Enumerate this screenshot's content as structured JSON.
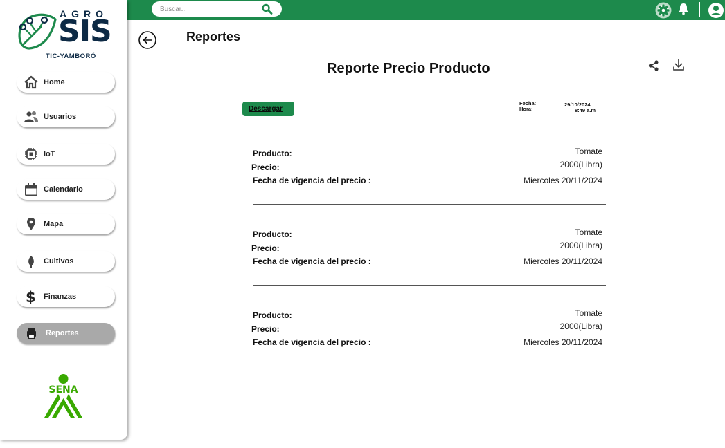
{
  "search": {
    "placeholder": "Buscar..."
  },
  "logo": {
    "brand_top": "AGRO",
    "brand_main": "SIS",
    "brand_sub": "TIC-YAMBORÓ"
  },
  "sidebar": {
    "items": [
      {
        "label": "Home",
        "icon": "home-icon"
      },
      {
        "label": "Usuarios",
        "icon": "users-icon"
      },
      {
        "label": "IoT",
        "icon": "chip-icon"
      },
      {
        "label": "Calendario",
        "icon": "calendar-icon"
      },
      {
        "label": "Mapa",
        "icon": "map-pin-icon"
      },
      {
        "label": "Cultivos",
        "icon": "leaf-icon"
      },
      {
        "label": "Finanzas",
        "icon": "dollar-icon"
      },
      {
        "label": "Reportes",
        "icon": "printer-icon",
        "active": true
      }
    ],
    "footer_logo_text": "SENA"
  },
  "header": {
    "title": "Reportes"
  },
  "report": {
    "title": "Reporte Precio Producto",
    "download_label": "Descargar",
    "fecha_label": "Fecha:",
    "fecha_value": "29/10/2024",
    "hora_label": "Hora:",
    "hora_value": "8:49 a.m",
    "records": [
      {
        "producto_label": "Producto:",
        "producto": "Tomate",
        "precio_label": "Precio:",
        "precio": "2000(Libra)",
        "vigencia_label": "Fecha de vigencia del precio :",
        "vigencia": "Miercoles 20/11/2024"
      },
      {
        "producto_label": "Producto:",
        "producto": "Tomate",
        "precio_label": "Precio:",
        "precio": "2000(Libra)",
        "vigencia_label": "Fecha de vigencia del precio :",
        "vigencia": "Miercoles 20/11/2024"
      },
      {
        "producto_label": "Producto:",
        "producto": "Tomate",
        "precio_label": "Precio:",
        "precio": "2000(Libra)",
        "vigencia_label": "Fecha de vigencia del precio :",
        "vigencia": "Miercoles 20/11/2024"
      }
    ]
  },
  "colors": {
    "brand_green": "#1d8a4c",
    "sena_green": "#39a900",
    "logo_navy": "#0d2a45",
    "active_nav": "#a9a9a9"
  }
}
